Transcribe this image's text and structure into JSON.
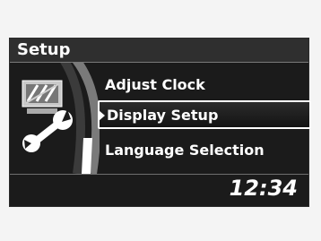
{
  "header": {
    "title": "Setup"
  },
  "menu": {
    "items": [
      {
        "label": "Adjust Clock",
        "selected": false
      },
      {
        "label": "Display Setup",
        "selected": true
      },
      {
        "label": "Language Selection",
        "selected": false
      }
    ]
  },
  "status": {
    "time": "12:34"
  },
  "icons": {
    "display": "display-icon",
    "settings": "wrench-icon",
    "selection": "right-arrow-icon"
  },
  "colors": {
    "screen_bg": "#1b1b1b",
    "header_bg": "#2f2f2f",
    "text": "#ffffff",
    "highlight": "#ffffff"
  }
}
